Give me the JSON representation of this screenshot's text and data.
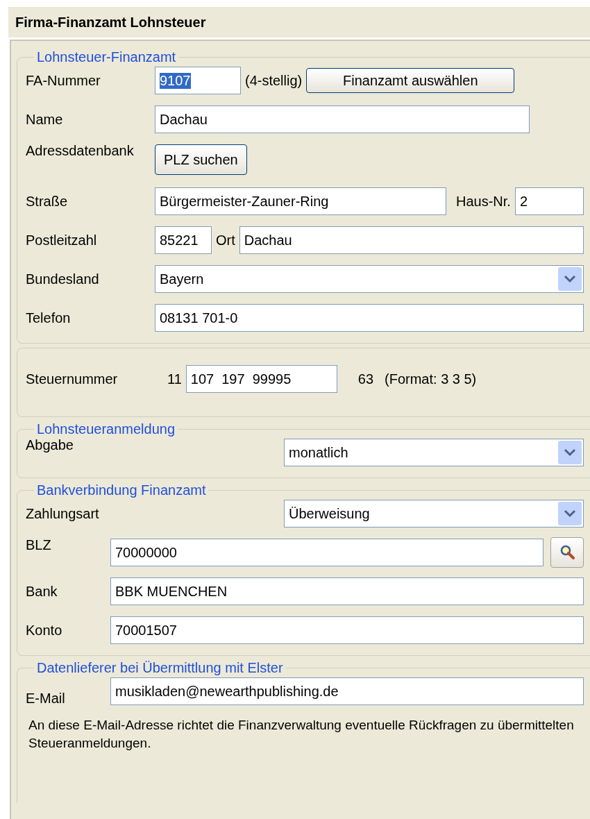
{
  "title": "Firma-Finanzamt Lohnsteuer",
  "finanzamt": {
    "legend": "Lohnsteuer-Finanzamt",
    "fa_nummer": {
      "label": "FA-Nummer",
      "value": "9107",
      "text_selected": true,
      "hint": "(4-stellig)",
      "button": "Finanzamt auswählen"
    },
    "name": {
      "label": "Name",
      "value": "Dachau"
    },
    "adressdatenbank": {
      "label": "Adressdatenbank",
      "button": "PLZ suchen"
    },
    "strasse": {
      "label": "Straße",
      "value": "Bürgermeister-Zauner-Ring",
      "hausnr_label": "Haus-Nr.",
      "hausnr": "2"
    },
    "plz": {
      "label": "Postleitzahl",
      "value": "85221",
      "ort_label": "Ort",
      "ort": "Dachau"
    },
    "bundesland": {
      "label": "Bundesland",
      "value": "Bayern"
    },
    "telefon": {
      "label": "Telefon",
      "value": "08131 701-0"
    }
  },
  "steuernummer": {
    "label": "Steuernummer",
    "prefix": "11",
    "value": "107  197  99995",
    "suffix": "63",
    "format": "(Format: 3 3 5)"
  },
  "anmeldung": {
    "legend": "Lohnsteueranmeldung",
    "label": "Abgabe",
    "value": "monatlich"
  },
  "bank": {
    "legend": "Bankverbindung Finanzamt",
    "zahlungsart": {
      "label": "Zahlungsart",
      "value": "Überweisung"
    },
    "blz": {
      "label": "BLZ",
      "value": "70000000"
    },
    "bank": {
      "label": "Bank",
      "value": "BBK MUENCHEN"
    },
    "konto": {
      "label": "Konto",
      "value": "70001507"
    }
  },
  "elster": {
    "legend": "Datenlieferer bei Übermittlung mit Elster",
    "label": "E-Mail",
    "value": "musikladen@newearthpublishing.de",
    "note": "An diese E-Mail-Adresse richtet die Finanzverwaltung eventuelle Rückfragen zu übermittelten Steueranmeldungen."
  }
}
